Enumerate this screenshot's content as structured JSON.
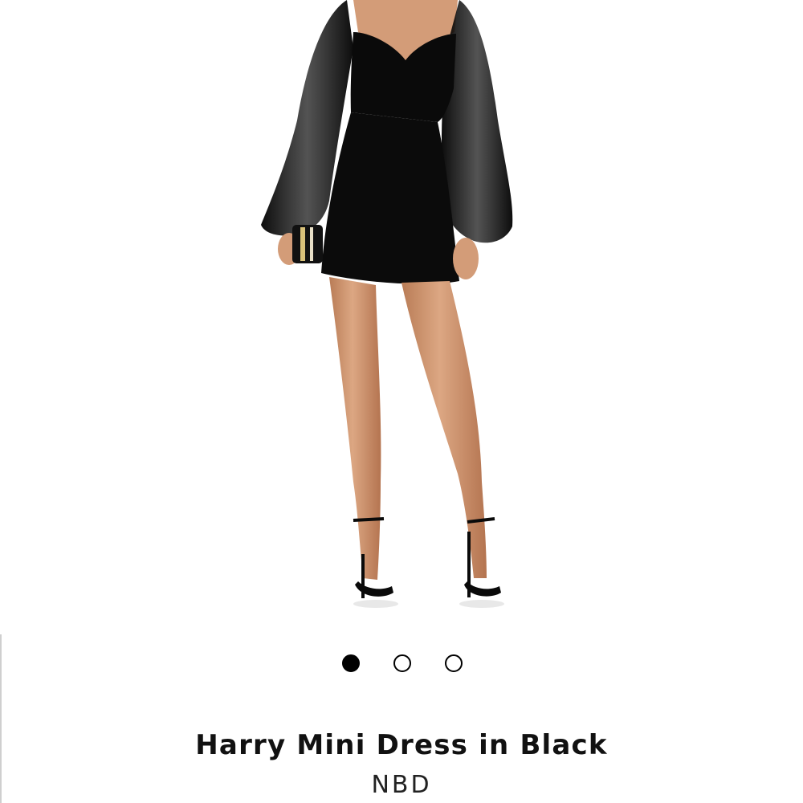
{
  "product": {
    "title": "Harry Mini Dress in Black",
    "brand": "NBD"
  },
  "gallery": {
    "image_count": 3,
    "active_index": 0,
    "dress_color": "#0b0b0b",
    "skin_color": "#d7a07a"
  }
}
